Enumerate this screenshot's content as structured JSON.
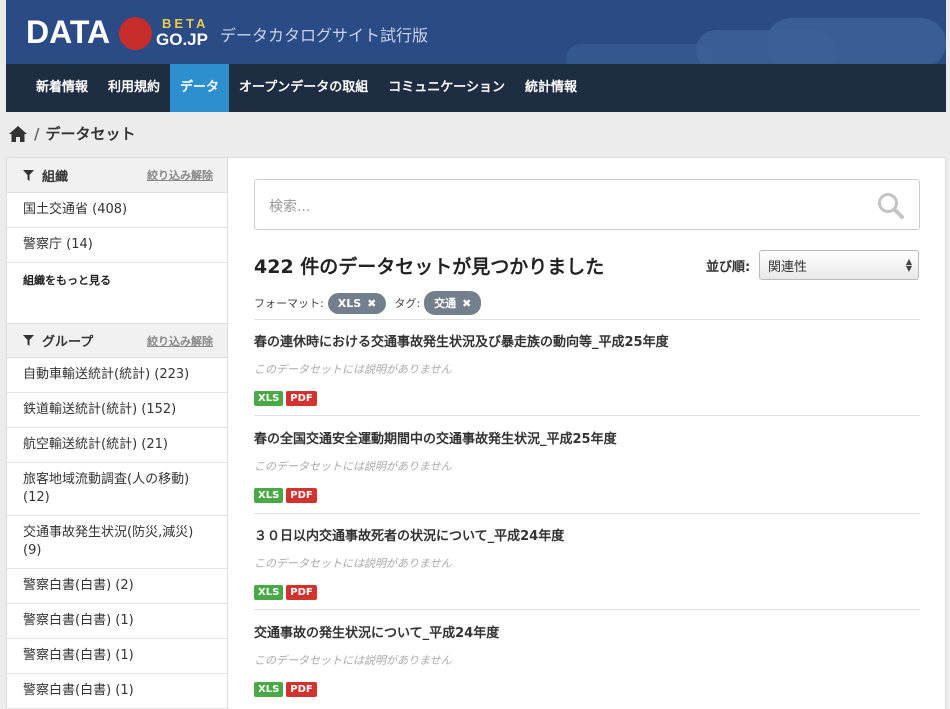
{
  "header": {
    "logo_data": "DATA",
    "logo_beta": "BETA",
    "logo_gojp": "GO.JP",
    "subtitle": "データカタログサイト試行版"
  },
  "nav": {
    "items": [
      "新着情報",
      "利用規約",
      "データ",
      "オープンデータの取組",
      "コミュニケーション",
      "統計情報"
    ],
    "active_index": 2
  },
  "breadcrumb": {
    "home_icon": "home-icon",
    "separator": "/",
    "current": "データセット"
  },
  "sidebar": {
    "org": {
      "title": "組織",
      "clear": "絞り込み解除",
      "items": [
        "国土交通省 (408)",
        "警察庁 (14)"
      ],
      "more": "組織をもっと見る"
    },
    "group": {
      "title": "グループ",
      "clear": "絞り込み解除",
      "items": [
        "自動車輸送統計(統計) (223)",
        "鉄道輸送統計(統計) (152)",
        "航空輸送統計(統計) (21)",
        "旅客地域流動調査(人の移動) (12)",
        "交通事故発生状況(防災,減災) (9)",
        "警察白書(白書) (2)",
        "警察白書(白書) (1)",
        "警察白書(白書) (1)",
        "警察白書(白書) (1)"
      ]
    }
  },
  "search": {
    "placeholder": "検索...",
    "icon": "search-icon"
  },
  "results": {
    "count_text": "422 件のデータセットが見つかりました",
    "sort_label": "並び順:",
    "sort_value": "関連性",
    "facet_format_label": "フォーマット:",
    "facet_format_value": "XLS",
    "facet_tag_label": "タグ:",
    "facet_tag_value": "交通",
    "remove_glyph": "✖"
  },
  "datasets": [
    {
      "title": "春の連休時における交通事故発生状況及び暴走族の動向等_平成25年度",
      "desc": "このデータセットには説明がありません",
      "formats": [
        "XLS",
        "PDF"
      ]
    },
    {
      "title": "春の全国交通安全運動期間中の交通事故発生状況_平成25年度",
      "desc": "このデータセットには説明がありません",
      "formats": [
        "XLS",
        "PDF"
      ]
    },
    {
      "title": "３０日以内交通事故死者の状況について_平成24年度",
      "desc": "このデータセットには説明がありません",
      "formats": [
        "XLS",
        "PDF"
      ]
    },
    {
      "title": "交通事故の発生状況について_平成24年度",
      "desc": "このデータセットには説明がありません",
      "formats": [
        "XLS",
        "PDF"
      ]
    }
  ],
  "colors": {
    "header_bg": "#2a4b86",
    "nav_bg": "#1f2d42",
    "nav_active": "#2d8fcd",
    "xls_badge": "#4aa847",
    "pdf_badge": "#d2332e",
    "logo_circle": "#c62d2a"
  }
}
